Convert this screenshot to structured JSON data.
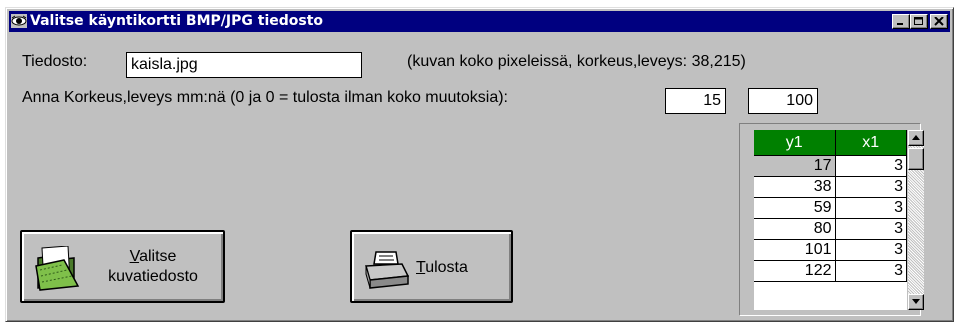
{
  "window": {
    "title": "Valitse käyntikortti BMP/JPG tiedosto",
    "title_icon": "eye-icon",
    "controls": [
      "minimize-icon",
      "maximize-icon",
      "close-icon"
    ]
  },
  "form": {
    "file_label": "Tiedosto:",
    "file_value": "kaisla.jpg",
    "size_info": "(kuvan koko pixeleissä, korkeus,leveys: 38,215)",
    "dims_label": "Anna Korkeus,leveys mm:nä (0 ja 0 = tulosta ilman koko muutoksia):",
    "height_value": "15",
    "width_value": "100"
  },
  "buttons": {
    "select": {
      "line1_mnemonic": "V",
      "line1_rest": "alitse",
      "line2": "kuvatiedosto",
      "icon": "folder-icon"
    },
    "print": {
      "mnemonic": "T",
      "rest": "ulosta",
      "icon": "printer-icon"
    }
  },
  "grid": {
    "columns": [
      "y1",
      "x1"
    ],
    "rows": [
      [
        "17",
        "3"
      ],
      [
        "38",
        "3"
      ],
      [
        "59",
        "3"
      ],
      [
        "80",
        "3"
      ],
      [
        "101",
        "3"
      ],
      [
        "122",
        "3"
      ]
    ],
    "selected_row": 0
  },
  "colors": {
    "titlebar": "#000080",
    "face": "#c0c0c0",
    "grid_header": "#008000"
  }
}
